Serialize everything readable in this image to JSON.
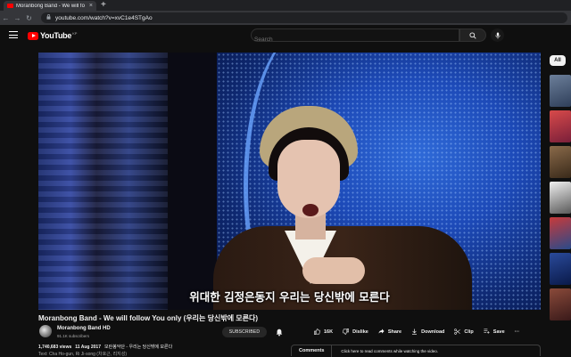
{
  "browser": {
    "tab_title": "Moranbong Band - We will fo",
    "tab_close": "×",
    "new_tab": "+",
    "back": "←",
    "forward": "→",
    "reload": "↻",
    "url": "youtube.com/watch?v=xvC1e4STgAo"
  },
  "header": {
    "logo_text": "YouTube",
    "logo_country": "KP",
    "search_placeholder": "Search"
  },
  "video": {
    "subtitle": "위대한 김정은동지 우리는 당신밖에 모른다",
    "title": "Moranbong Band - We will follow You only (우리는 당신밖에 모른다)"
  },
  "chips": {
    "all": "All"
  },
  "channel": {
    "name": "Moranbong Band HD",
    "subscribers": "91.1K subscribers",
    "subscribe_label": "SUBSCRIBED"
  },
  "actions": {
    "like_count": "16K",
    "dislike": "Dislike",
    "share": "Share",
    "download": "Download",
    "clip": "Clip",
    "save": "Save",
    "more": "···"
  },
  "description": {
    "views": "1,740,683 views",
    "date": "11 Aug 2017",
    "tags": "모란봉악단 - 우리는 당신밖에 모른다",
    "credit": "Text: Cha Ho-gun, Ri Ji-song (차호근, 리지성)"
  },
  "comments": {
    "label": "Comments",
    "hint": "Click here to read comments while watching the video."
  },
  "colors": {
    "background": "#0f0f0f",
    "brand_red": "#ff0000",
    "text": "#f1f1f1",
    "muted": "#aaaaaa"
  }
}
